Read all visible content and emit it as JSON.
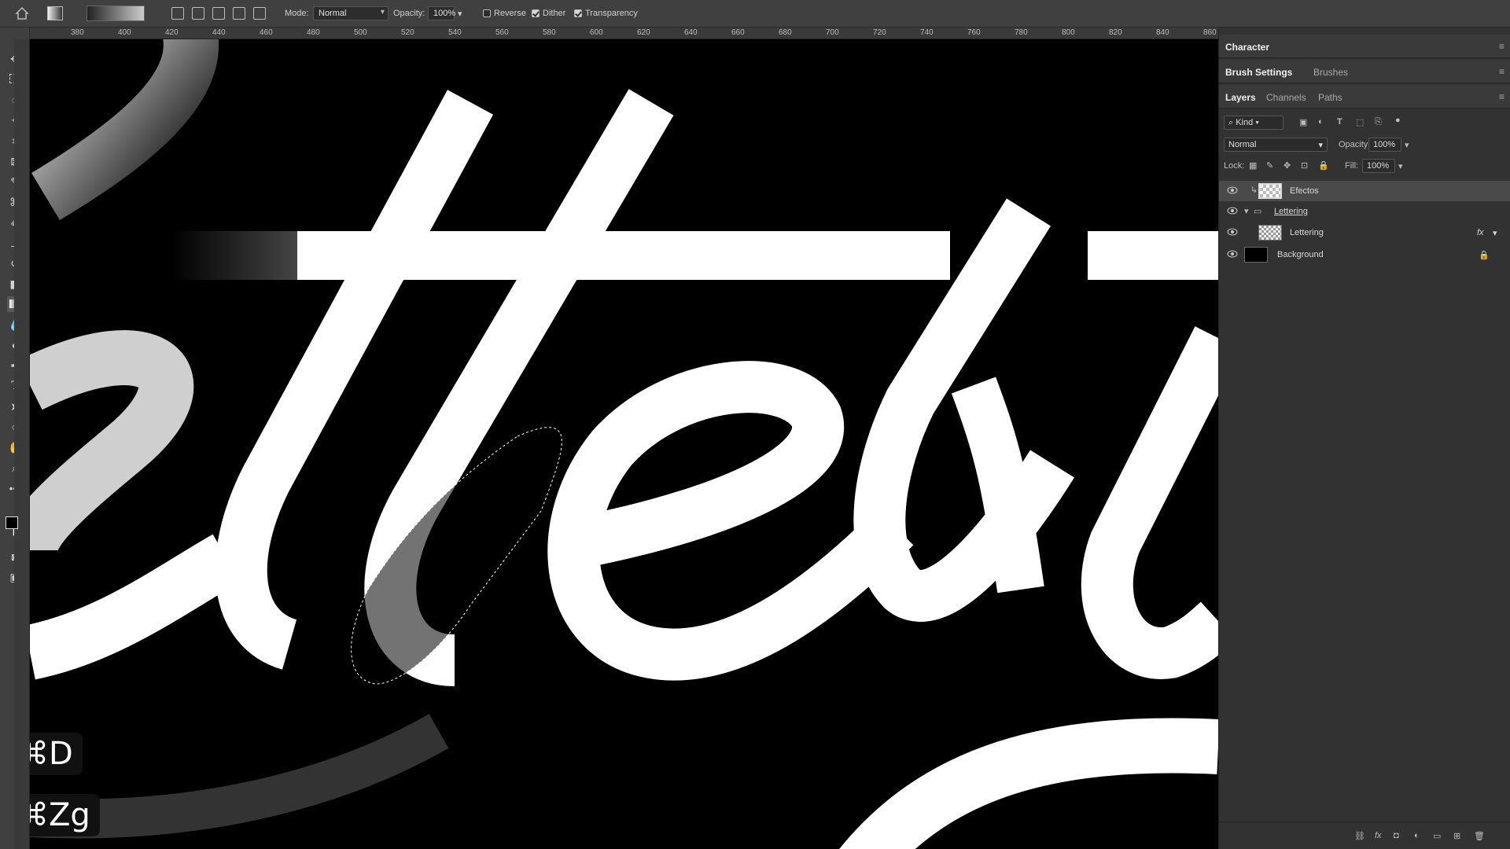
{
  "options_bar": {
    "mode_label": "Mode:",
    "mode_value": "Normal",
    "opacity_label": "Opacity:",
    "opacity_value": "100%",
    "reverse_label": "Reverse",
    "dither_label": "Dither",
    "transparency_label": "Transparency",
    "reverse_checked": false,
    "dither_checked": true,
    "transparency_checked": true
  },
  "ruler": {
    "ticks": [
      "380",
      "400",
      "420",
      "440",
      "460",
      "480",
      "500",
      "520",
      "540",
      "560",
      "580",
      "600",
      "620",
      "640",
      "660",
      "680",
      "700",
      "720",
      "740",
      "760",
      "780",
      "800",
      "820",
      "840",
      "860"
    ]
  },
  "panels": {
    "character_tab": "Character",
    "brush_settings_tab": "Brush Settings",
    "brushes_tab": "Brushes",
    "layers_tab": "Layers",
    "channels_tab": "Channels",
    "paths_tab": "Paths",
    "kind_filter": "Kind",
    "blend_mode": "Normal",
    "opacity_label": "Opacity:",
    "opacity_value": "100%",
    "lock_label": "Lock:",
    "fill_label": "Fill:",
    "fill_value": "100%",
    "layers": [
      {
        "name": "Efectos"
      },
      {
        "name": "Lettering"
      },
      {
        "name": "Lettering",
        "fx": "fx"
      },
      {
        "name": "Background"
      }
    ]
  },
  "shortcuts": {
    "deselect": "⌘D",
    "undo": "⌘Zg"
  },
  "colors": {
    "canvas_bg": "#000000",
    "lettering": "#ffffff",
    "logo_red": "#d0121b"
  }
}
